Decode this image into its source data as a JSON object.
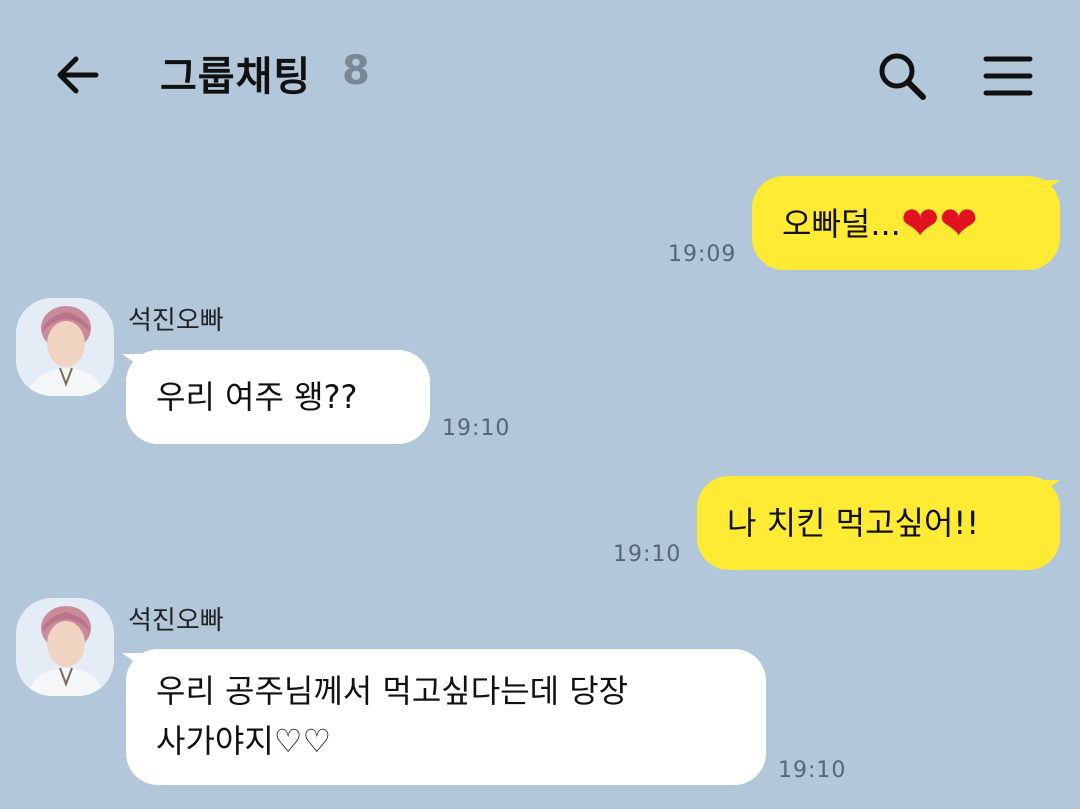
{
  "header": {
    "title": "그룹채팅",
    "member_count": "8",
    "icons": {
      "back": "back-arrow-icon",
      "search": "search-icon",
      "menu": "hamburger-menu-icon"
    }
  },
  "messages": [
    {
      "side": "mine",
      "text": "오빠덜...",
      "emoji": "❤❤",
      "time": "19:09"
    },
    {
      "side": "theirs",
      "sender": "석진오빠",
      "text": "우리 여주 왱??",
      "time": "19:10"
    },
    {
      "side": "mine",
      "text": "나 치킨 먹고싶어!!",
      "time": "19:10"
    },
    {
      "side": "theirs",
      "sender": "석진오빠",
      "line1": "우리 공주님께서 먹고싶다는데 당장",
      "line2": "사가야지♡♡",
      "time": "19:10"
    }
  ],
  "colors": {
    "background": "#b2c7da",
    "my_bubble": "#ffeb33",
    "their_bubble": "#ffffff",
    "heart": "#e0121f"
  }
}
